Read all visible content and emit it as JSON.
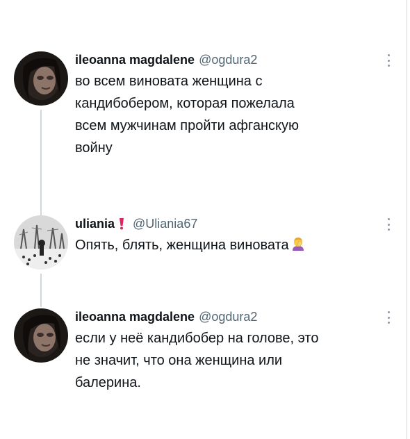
{
  "tweets": [
    {
      "author": "ileoanna magdalene",
      "handle": "@ogdura2",
      "text": "во всем виновата женщина с\nкандибобером, которая пожелала\nвсем мужчинам пройти афганскую\nвойну",
      "avatar_icon": "girl-portrait-avatar",
      "more_icon": "more-options-icon"
    },
    {
      "author": "uliania",
      "badge_icon": "red-exclamation-icon",
      "handle": "@Uliania67",
      "text": "Опять, блять, женщина виновата",
      "emoji_icon": "woman-facepalming-emoji",
      "avatar_icon": "winter-trees-birds-avatar",
      "more_icon": "more-options-icon"
    },
    {
      "author": "ileoanna magdalene",
      "handle": "@ogdura2",
      "text": "если у неё кандибобер на голове, это\nне значит, что она женщина или\nбалерина.",
      "avatar_icon": "girl-portrait-avatar",
      "more_icon": "more-options-icon"
    }
  ],
  "colors": {
    "text": "#0f1419",
    "handle": "#536471",
    "thread_line": "#cfd9de",
    "badge": "#e0245e"
  }
}
